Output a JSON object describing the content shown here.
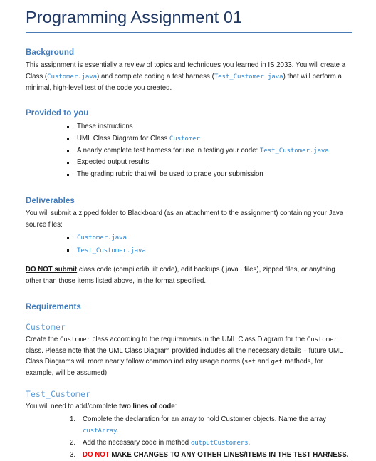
{
  "document": {
    "title": "Programming Assignment 01"
  },
  "sections": {
    "background": {
      "heading": "Background",
      "para_1a": "This assignment is essentially a review of topics and techniques you learned in IS 2033. You will create a Class (",
      "code_1": "Customer.java",
      "para_1b": ") and complete coding a test harness (",
      "code_2": "Test_Customer.java",
      "para_1c": ") that will perform a minimal, high-level test of the code you created."
    },
    "provided": {
      "heading": "Provided to you",
      "items": [
        {
          "text": "These instructions"
        },
        {
          "text": "UML Class Diagram for Class ",
          "code": "Customer",
          "text_after": ""
        },
        {
          "text": "A nearly complete test harness for use in testing your code:  ",
          "code": "Test_Customer.java",
          "text_after": ""
        },
        {
          "text": "Expected output results"
        },
        {
          "text": "The grading rubric that will be used to grade your submission"
        }
      ]
    },
    "deliverables": {
      "heading": "Deliverables",
      "intro": "You will submit a zipped folder to Blackboard (as an attachment to the assignment) containing your Java source files:",
      "files": [
        "Customer.java",
        "Test_Customer.java"
      ],
      "warning_bold": "DO NOT submit",
      "warning_rest": " class code (compiled/built code), edit backups (.java~ files), zipped files, or anything other than those items listed above, in the format specified."
    },
    "requirements": {
      "heading": "Requirements",
      "customer": {
        "subheading": "Customer",
        "p_a": "Create the ",
        "code_a": "Customer",
        "p_b": " class according to the requirements in the UML Class Diagram for the ",
        "code_b": "Customer",
        "p_c": " class. Please note that the UML Class Diagram provided includes all the necessary details – future UML Class Diagrams will more nearly follow common industry usage norms (",
        "code_c": "set",
        "p_d": " and ",
        "code_d": "get",
        "p_e": " methods, for example, will be assumed)."
      },
      "test_customer": {
        "subheading": "Test_Customer",
        "intro_a": "You will need to add/complete ",
        "intro_bold": "two lines of code",
        "intro_b": ":",
        "steps": [
          {
            "text_a": "Complete the declaration for an array to hold Customer objects. Name the array ",
            "code": "custArray",
            "text_b": "."
          },
          {
            "text_a": "Add the necessary code in method ",
            "code": "outputCustomers",
            "text_b": "."
          },
          {
            "red": "DO NOT",
            "bold_rest": " MAKE CHANGES TO ANY OTHER LINES/ITEMS IN THE TEST HARNESS."
          }
        ]
      }
    }
  },
  "colors": {
    "title": "#1f3864",
    "rule": "#4a7ab5",
    "heading": "#3f7cc0",
    "subheading": "#5b9bd5",
    "code": "#2e8bd8",
    "alert": "#ff0000",
    "body": "#1a1a1a"
  }
}
